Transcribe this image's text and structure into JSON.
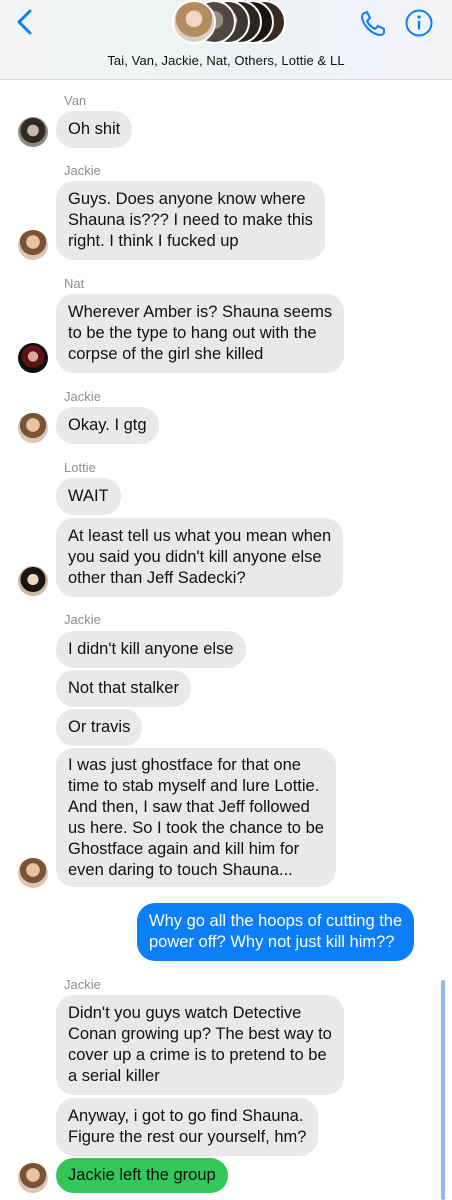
{
  "header": {
    "title": "Tai, Van, Jackie, Nat, Others, Lottie & LL",
    "back_icon": "chevron-left-icon",
    "call_icon": "phone-icon",
    "info_icon": "info-icon",
    "accent_color": "#0b7ef8"
  },
  "messages": [
    {
      "sender": "Van",
      "text": "Oh shit"
    },
    {
      "sender": "Jackie",
      "text": "Guys. Does anyone know where\nShauna is??? I need to make this\nright. I think I fucked up"
    },
    {
      "sender": "Nat",
      "text": "Wherever Amber is? Shauna seems\nto be the type to hang out with the\ncorpse of the girl she killed"
    },
    {
      "sender": "Jackie",
      "text": "Okay. I gtg"
    },
    {
      "sender": "Lottie",
      "text": "WAIT"
    },
    {
      "text": "At least tell us what you mean when\nyou said you didn't kill anyone else\nother than Jeff Sadecki?"
    },
    {
      "sender": "Jackie",
      "text": "I didn't kill anyone else"
    },
    {
      "text": "Not that stalker"
    },
    {
      "text": "Or travis"
    },
    {
      "text": "I was just ghostface for that one\ntime to stab myself and lure Lottie.\nAnd then, I saw that Jeff followed\nus here. So I took the chance to be\nGhostface again and kill him for\neven daring to touch Shauna..."
    },
    {
      "from_me": true,
      "text": "Why go all the hoops of cutting the\npower off? Why not just kill him??"
    },
    {
      "sender": "Jackie",
      "text": "Didn't you guys watch Detective\nConan growing up? The best way to\ncover up a crime is to pretend to be\na serial killer"
    },
    {
      "text": "Anyway, i got to go find Shauna.\nFigure the rest our yourself, hm?"
    },
    {
      "text": "Jackie left the group",
      "color": "#35c759"
    }
  ],
  "colors": {
    "incoming_bubble": "#e9e9eb",
    "outgoing_bubble": "#0b7ef8",
    "system_bubble": "#35c759"
  }
}
